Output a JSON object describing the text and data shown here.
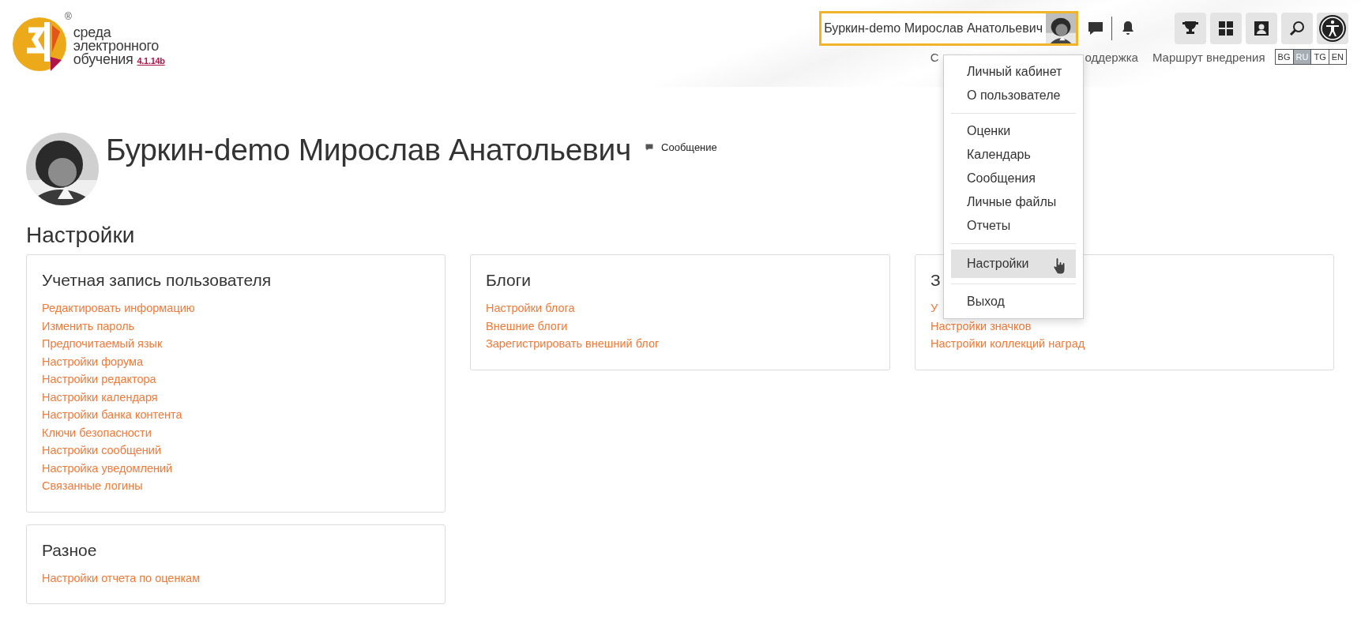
{
  "header": {
    "logo": {
      "lines": [
        "среда",
        "электронного",
        "обучения"
      ],
      "version": "4.1.14b",
      "registered": "®"
    },
    "user_menu": {
      "name": "Буркин-demo Мирослав Анатольевич",
      "open": true
    },
    "nav": [
      {
        "text": "С"
      },
      {
        "text": "оддержка"
      },
      {
        "text": "Маршрут внедрения"
      }
    ],
    "languages": [
      {
        "label": "BG",
        "selected": false
      },
      {
        "label": "RU",
        "selected": true
      },
      {
        "label": "TG",
        "selected": false
      },
      {
        "label": "EN",
        "selected": false
      }
    ]
  },
  "dropdown": {
    "sections": [
      [
        {
          "label": "Личный кабинет",
          "selected": false
        },
        {
          "label": "О пользователе",
          "selected": false
        }
      ],
      [
        {
          "label": "Оценки",
          "selected": false
        },
        {
          "label": "Календарь",
          "selected": false
        },
        {
          "label": "Сообщения",
          "selected": false
        },
        {
          "label": "Личные файлы",
          "selected": false
        },
        {
          "label": "Отчеты",
          "selected": false
        }
      ],
      [
        {
          "label": "Настройки",
          "selected": true
        }
      ],
      [
        {
          "label": "Выход",
          "selected": false
        }
      ]
    ]
  },
  "profile": {
    "name": "Буркин-demo Мирослав Анатольевич",
    "message_label": "Сообщение"
  },
  "settings_title": "Настройки",
  "columns": [
    [
      {
        "title": "Учетная запись пользователя",
        "links": [
          "Редактировать информацию",
          "Изменить пароль",
          "Предпочитаемый язык",
          "Настройки форума",
          "Настройки редактора",
          "Настройки календаря",
          "Настройки банка контента",
          "Ключи безопасности",
          "Настройки сообщений",
          "Настройка уведомлений",
          "Связанные логины"
        ]
      },
      {
        "title": "Разное",
        "links": [
          "Настройки отчета по оценкам"
        ]
      }
    ],
    [
      {
        "title": "Блоги",
        "links": [
          "Настройки блога",
          "Внешние блоги",
          "Зарегистрировать внешний блог"
        ]
      }
    ],
    [
      {
        "title": "З",
        "links": [
          "У",
          "Настройки значков",
          "Настройки коллекций наград"
        ]
      }
    ]
  ]
}
